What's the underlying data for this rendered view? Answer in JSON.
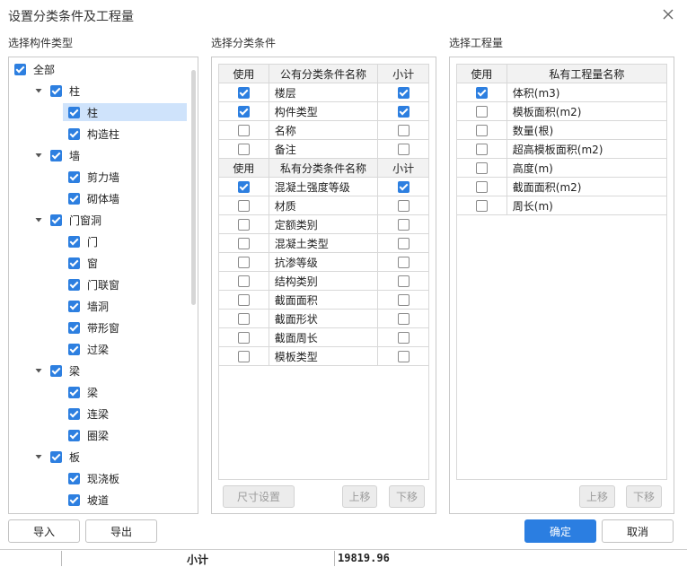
{
  "dialog": {
    "title": "设置分类条件及工程量"
  },
  "sections": {
    "component_type": "选择构件类型",
    "classify_condition": "选择分类条件",
    "quantity": "选择工程量"
  },
  "tree": [
    {
      "label": "全部",
      "level": 0,
      "arrow": false,
      "checked": true,
      "selected": false
    },
    {
      "label": "柱",
      "level": 1,
      "arrow": true,
      "checked": true,
      "selected": false
    },
    {
      "label": "柱",
      "level": 2,
      "arrow": false,
      "checked": true,
      "selected": true
    },
    {
      "label": "构造柱",
      "level": 2,
      "arrow": false,
      "checked": true,
      "selected": false
    },
    {
      "label": "墙",
      "level": 1,
      "arrow": true,
      "checked": true,
      "selected": false
    },
    {
      "label": "剪力墙",
      "level": 2,
      "arrow": false,
      "checked": true,
      "selected": false
    },
    {
      "label": "砌体墙",
      "level": 2,
      "arrow": false,
      "checked": true,
      "selected": false
    },
    {
      "label": "门窗洞",
      "level": 1,
      "arrow": true,
      "checked": true,
      "selected": false
    },
    {
      "label": "门",
      "level": 2,
      "arrow": false,
      "checked": true,
      "selected": false
    },
    {
      "label": "窗",
      "level": 2,
      "arrow": false,
      "checked": true,
      "selected": false
    },
    {
      "label": "门联窗",
      "level": 2,
      "arrow": false,
      "checked": true,
      "selected": false
    },
    {
      "label": "墙洞",
      "level": 2,
      "arrow": false,
      "checked": true,
      "selected": false
    },
    {
      "label": "带形窗",
      "level": 2,
      "arrow": false,
      "checked": true,
      "selected": false
    },
    {
      "label": "过梁",
      "level": 2,
      "arrow": false,
      "checked": true,
      "selected": false
    },
    {
      "label": "梁",
      "level": 1,
      "arrow": true,
      "checked": true,
      "selected": false
    },
    {
      "label": "梁",
      "level": 2,
      "arrow": false,
      "checked": true,
      "selected": false
    },
    {
      "label": "连梁",
      "level": 2,
      "arrow": false,
      "checked": true,
      "selected": false
    },
    {
      "label": "圈梁",
      "level": 2,
      "arrow": false,
      "checked": true,
      "selected": false
    },
    {
      "label": "板",
      "level": 1,
      "arrow": true,
      "checked": true,
      "selected": false
    },
    {
      "label": "现浇板",
      "level": 2,
      "arrow": false,
      "checked": true,
      "selected": false
    },
    {
      "label": "坡道",
      "level": 2,
      "arrow": false,
      "checked": true,
      "selected": false
    }
  ],
  "condition_table": {
    "public_headers": [
      "使用",
      "公有分类条件名称",
      "小计"
    ],
    "public_rows": [
      {
        "use": true,
        "name": "楼层",
        "subtotal": true
      },
      {
        "use": true,
        "name": "构件类型",
        "subtotal": true
      },
      {
        "use": false,
        "name": "名称",
        "subtotal": false
      },
      {
        "use": false,
        "name": "备注",
        "subtotal": false
      }
    ],
    "private_headers": [
      "使用",
      "私有分类条件名称",
      "小计"
    ],
    "private_rows": [
      {
        "use": true,
        "name": "混凝土强度等级",
        "subtotal": true
      },
      {
        "use": false,
        "name": "材质",
        "subtotal": false
      },
      {
        "use": false,
        "name": "定额类别",
        "subtotal": false
      },
      {
        "use": false,
        "name": "混凝土类型",
        "subtotal": false
      },
      {
        "use": false,
        "name": "抗渗等级",
        "subtotal": false
      },
      {
        "use": false,
        "name": "结构类别",
        "subtotal": false
      },
      {
        "use": false,
        "name": "截面面积",
        "subtotal": false
      },
      {
        "use": false,
        "name": "截面形状",
        "subtotal": false
      },
      {
        "use": false,
        "name": "截面周长",
        "subtotal": false
      },
      {
        "use": false,
        "name": "模板类型",
        "subtotal": false
      }
    ]
  },
  "quantity_table": {
    "headers": [
      "使用",
      "私有工程量名称"
    ],
    "rows": [
      {
        "use": true,
        "name": "体积(m3)"
      },
      {
        "use": false,
        "name": "模板面积(m2)"
      },
      {
        "use": false,
        "name": "数量(根)"
      },
      {
        "use": false,
        "name": "超高模板面积(m2)"
      },
      {
        "use": false,
        "name": "高度(m)"
      },
      {
        "use": false,
        "name": "截面面积(m2)"
      },
      {
        "use": false,
        "name": "周长(m)"
      }
    ]
  },
  "buttons": {
    "size_settings": "尺寸设置",
    "move_up": "上移",
    "move_down": "下移",
    "import": "导入",
    "export": "导出",
    "ok": "确定",
    "cancel": "取消"
  },
  "background_fragment": {
    "left": "小计",
    "right": "19819.96"
  },
  "colors": {
    "accent": "#2b7ee1",
    "selection": "#cfe3fb"
  }
}
